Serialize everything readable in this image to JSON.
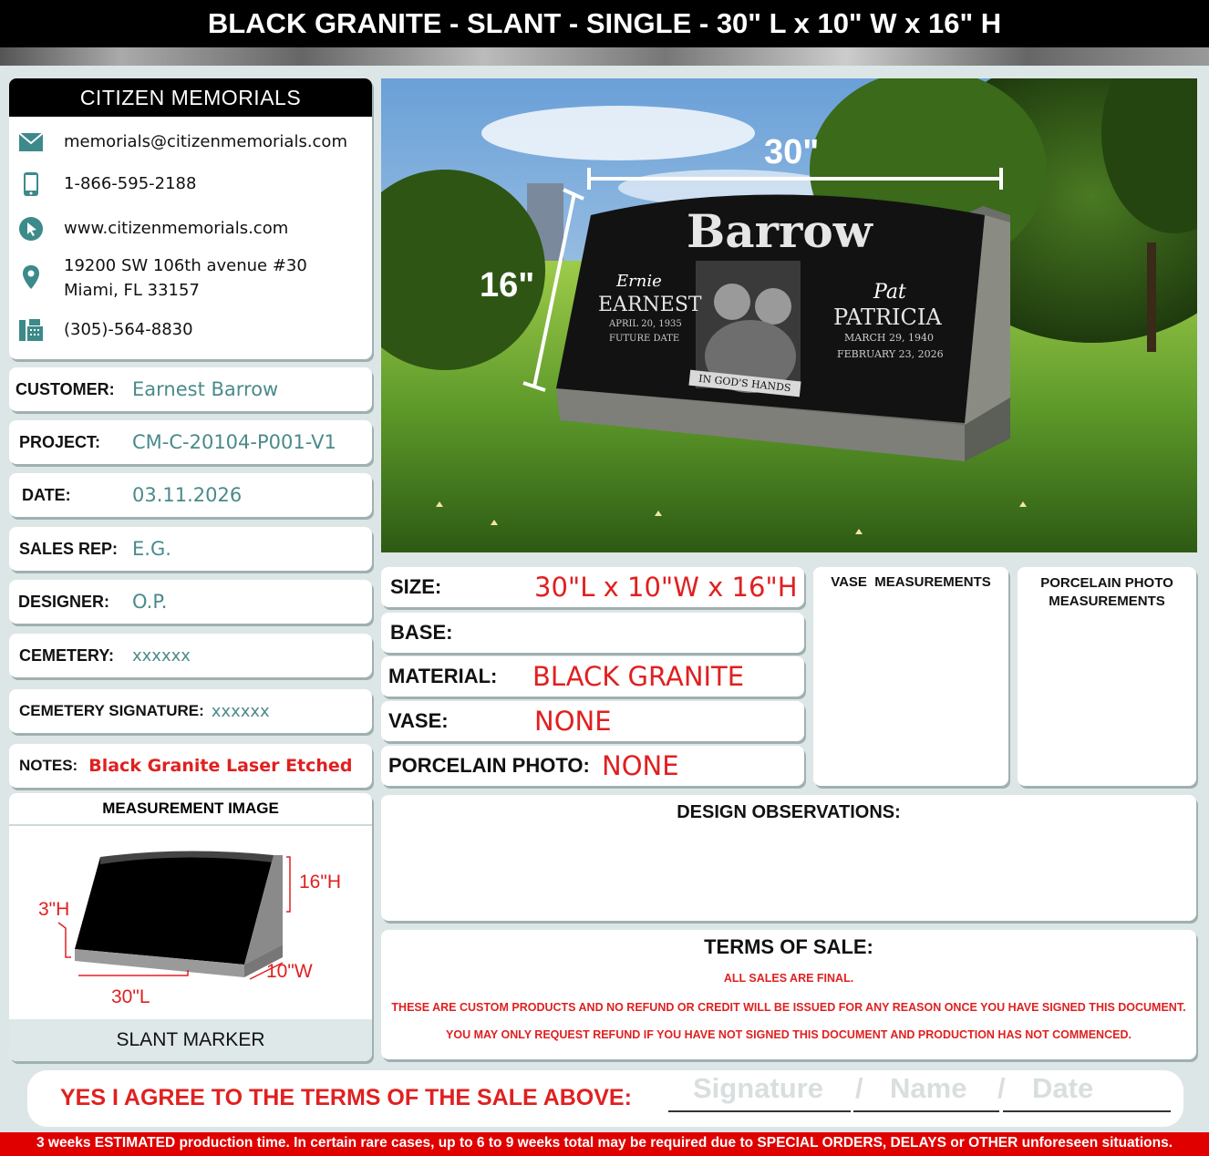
{
  "title": "BLACK GRANITE - SLANT - SINGLE - 30\" L x 10\" W x 16\" H",
  "company": {
    "name": "CITIZEN MEMORIALS",
    "email": "memorials@citizenmemorials.com",
    "phone": "1-866-595-2188",
    "website": "www.citizenmemorials.com",
    "address_line1": "19200 SW 106th avenue #30",
    "address_line2": "Miami, FL 33157",
    "fax": "(305)-564-8830"
  },
  "info": {
    "customer_label": "CUSTOMER:",
    "customer": "Earnest Barrow",
    "project_label": "PROJECT:",
    "project": "CM-C-20104-P001-V1",
    "date_label": "DATE:",
    "date": "03.11.2026",
    "sales_rep_label": "SALES REP:",
    "sales_rep": "E.G.",
    "designer_label": "DESIGNER:",
    "designer": "O.P.",
    "cemetery_label": "CEMETERY:",
    "cemetery": "xxxxxx",
    "cemetery_signature_label": "CEMETERY SIGNATURE:",
    "cemetery_signature": "xxxxxx",
    "notes_label": "NOTES:",
    "notes": "Black Granite Laser Etched"
  },
  "measurement": {
    "header": "MEASUREMENT IMAGE",
    "footer": "SLANT MARKER",
    "height_label": "16\"H",
    "base_label": "3\"H",
    "width_label": "10\"W",
    "length_label": "30\"L"
  },
  "photo": {
    "dim_width": "30\"",
    "dim_height": "16\"",
    "family_name": "Barrow",
    "left_nickname": "Ernie",
    "left_name": "EARNEST",
    "left_date1": "APRIL 20, 1935",
    "left_date2": "FUTURE DATE",
    "right_nickname": "Pat",
    "right_name": "PATRICIA",
    "right_date1": "MARCH 29, 1940",
    "right_date2": "FEBRUARY 23, 2026",
    "banner": "IN GOD'S HANDS"
  },
  "spec": {
    "size_label": "SIZE:",
    "size": "30\"L x 10\"W x 16\"H",
    "base_label": "BASE:",
    "base": "",
    "material_label": "MATERIAL:",
    "material": "BLACK GRANITE",
    "vase_label": "VASE:",
    "vase": "NONE",
    "porcelain_label": "PORCELAIN PHOTO:",
    "porcelain": "NONE"
  },
  "vase_measurements": "VASE  MEASUREMENTS",
  "porcelain_line1": "PORCELAIN PHOTO",
  "porcelain_line2": "MEASUREMENTS",
  "design_observations": "DESIGN OBSERVATIONS:",
  "terms": {
    "title": "TERMS OF SALE:",
    "line1": "ALL SALES ARE FINAL.",
    "line2": "THESE ARE CUSTOM PRODUCTS AND NO REFUND OR CREDIT WILL BE ISSUED FOR ANY REASON ONCE YOU HAVE SIGNED THIS DOCUMENT.",
    "line3": "YOU MAY ONLY REQUEST REFUND IF YOU HAVE NOT SIGNED THIS DOCUMENT AND PRODUCTION HAS NOT COMMENCED."
  },
  "agree": {
    "text": "YES I AGREE TO THE TERMS OF THE SALE ABOVE:",
    "sig": "Signature",
    "sep": "/",
    "name": "Name",
    "date": "Date"
  },
  "footer": "3 weeks ESTIMATED production time. In certain rare cases, up to  6 to 9 weeks total may be required due to SPECIAL ORDERS, DELAYS or OTHER unforeseen situations."
}
